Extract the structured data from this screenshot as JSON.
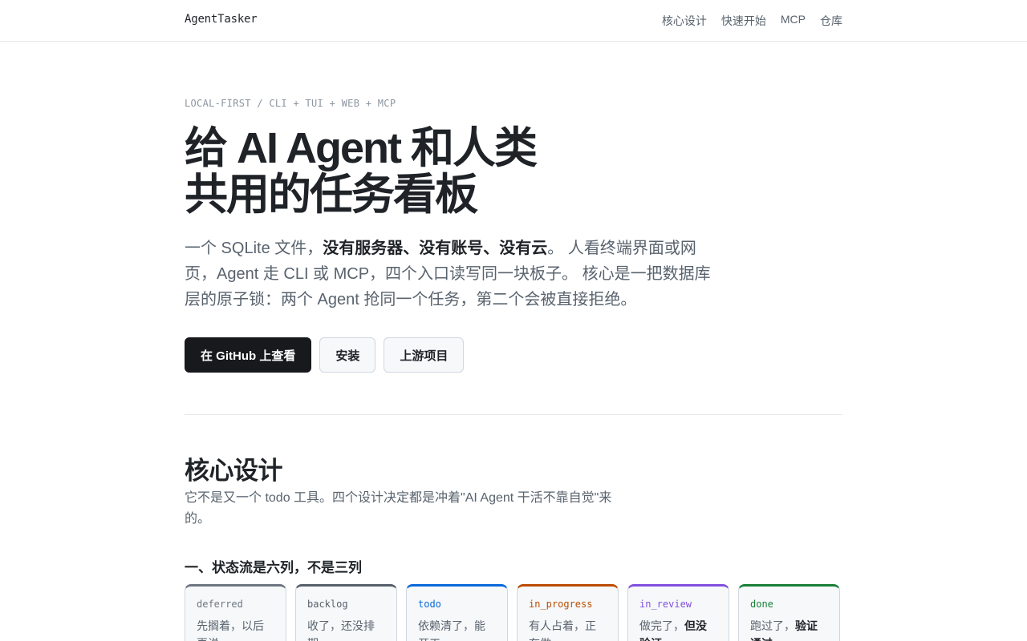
{
  "header": {
    "brand": "AgentTasker",
    "nav": [
      "核心设计",
      "快速开始",
      "MCP",
      "仓库"
    ]
  },
  "hero": {
    "kicker": "LOCAL-FIRST / CLI + TUI + WEB + MCP",
    "title_line1": "给 AI Agent 和人类",
    "title_line2": "共用的任务看板",
    "desc_prefix": "一个 SQLite 文件，",
    "desc_bold": "没有服务器、没有账号、没有云",
    "desc_suffix": "。 人看终端界面或网页，Agent 走 CLI 或 MCP，四个入口读写同一块板子。 核心是一把数据库层的原子锁：两个 Agent 抢同一个任务，第二个会被直接拒绝。"
  },
  "buttons": {
    "github": "在 GitHub 上查看",
    "install": "安装",
    "upstream": "上游项目"
  },
  "core": {
    "title": "核心设计",
    "desc": "它不是又一个 todo 工具。四个设计决定都是冲着\"AI Agent 干活不靠自觉\"来的。",
    "subtitle": "一、状态流是六列，不是三列"
  },
  "states": [
    {
      "name": "deferred",
      "text": "先搁着，以后再说",
      "bold": "",
      "color": "#6e7781"
    },
    {
      "name": "backlog",
      "text": "收了，还没排期",
      "bold": "",
      "color": "#57606a"
    },
    {
      "name": "todo",
      "text": "依赖清了，能开工",
      "bold": "",
      "color": "#0969da"
    },
    {
      "name": "in_progress",
      "text": "有人占着，正在做",
      "bold": "",
      "color": "#bc4c00"
    },
    {
      "name": "in_review",
      "text": "做完了，",
      "bold": "但没验证",
      "color": "#8250df"
    },
    {
      "name": "done",
      "text": "跑过了，",
      "bold": "验证通过",
      "color": "#1a7f37"
    }
  ]
}
